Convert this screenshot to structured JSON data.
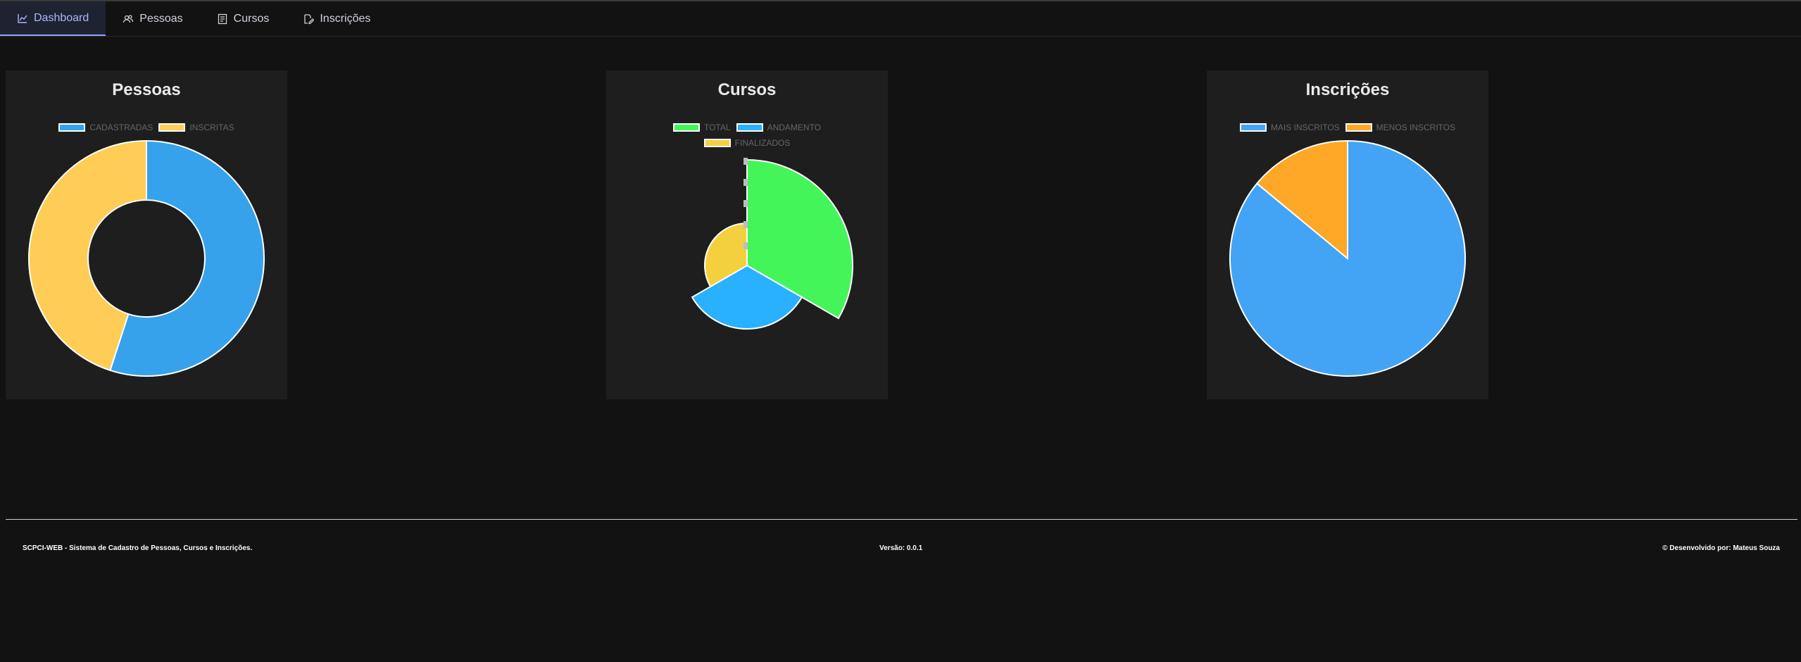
{
  "nav": {
    "tabs": [
      {
        "label": "Dashboard",
        "icon": "chart-line-icon",
        "active": true
      },
      {
        "label": "Pessoas",
        "icon": "users-icon",
        "active": false
      },
      {
        "label": "Cursos",
        "icon": "book-icon",
        "active": false
      },
      {
        "label": "Inscrições",
        "icon": "edit-icon",
        "active": false
      }
    ]
  },
  "cards": {
    "pessoas": {
      "title": "Pessoas"
    },
    "cursos": {
      "title": "Cursos"
    },
    "inscricoes": {
      "title": "Inscrições"
    }
  },
  "chart_data": [
    {
      "type": "pie",
      "variant": "doughnut",
      "title": "Pessoas",
      "categories": [
        "CADASTRADAS",
        "INSCRITAS"
      ],
      "values": [
        55,
        45
      ],
      "colors": [
        "#36a2eb",
        "#ffcd56"
      ]
    },
    {
      "type": "pie",
      "variant": "polar-area",
      "title": "Cursos",
      "categories": [
        "TOTAL",
        "ANDAMENTO",
        "FINALIZADOS"
      ],
      "values": [
        100,
        60,
        40
      ],
      "colors": [
        "#44f55a",
        "#29b0ff",
        "#f4d03f"
      ]
    },
    {
      "type": "pie",
      "title": "Inscrições",
      "categories": [
        "MAIS INSCRITOS",
        "MENOS INSCRITOS"
      ],
      "values": [
        86,
        14
      ],
      "colors": [
        "#43a4f5",
        "#ffa726"
      ]
    }
  ],
  "footer": {
    "left": "SCPCI-WEB - Sistema de Cadastro de Pessoas, Cursos e Inscrições.",
    "center": "Versão: 0.0.1",
    "right": "© Desenvolvido por: Mateus Souza"
  }
}
